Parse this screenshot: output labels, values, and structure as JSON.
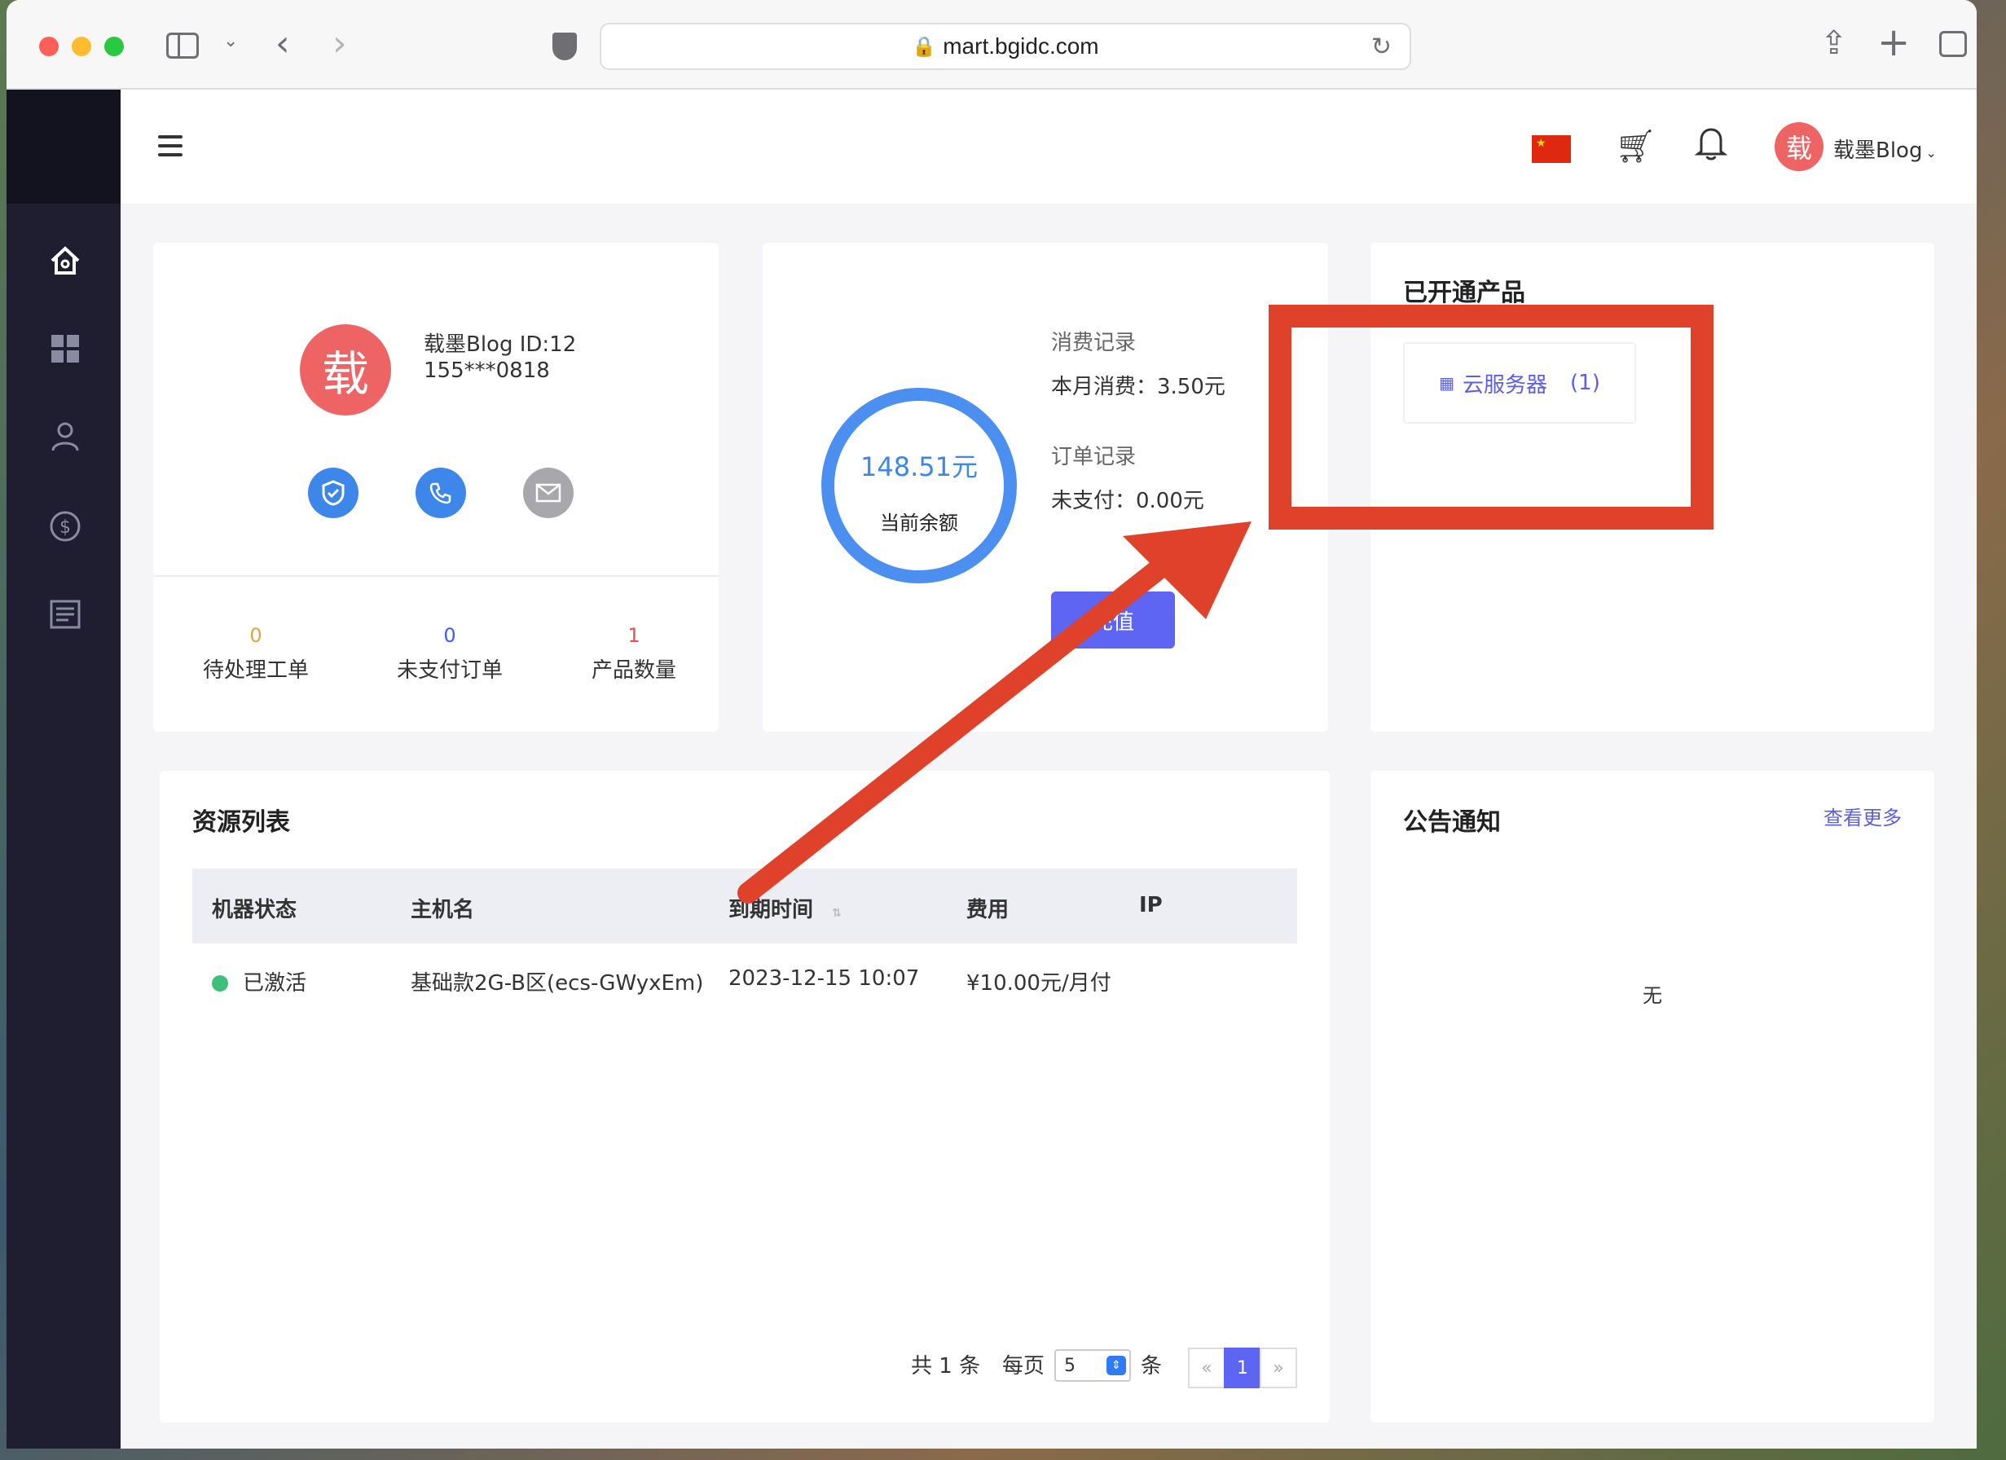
{
  "browser": {
    "url": "mart.bgidc.com"
  },
  "header": {
    "user_avatar_char": "载",
    "user_name": "载墨Blog",
    "caret": "⌄"
  },
  "profile": {
    "avatar_char": "载",
    "name_line": "载墨Blog ID:12",
    "phone": "155***0818",
    "stats": [
      {
        "value": "0",
        "label": "待处理工单",
        "color": "#e6a23c"
      },
      {
        "value": "0",
        "label": "未支付订单",
        "color": "#3d60e6"
      },
      {
        "value": "1",
        "label": "产品数量",
        "color": "#ee4d4d"
      }
    ]
  },
  "balance": {
    "amount": "148.51元",
    "label": "当前余额",
    "consume_title": "消费记录",
    "consume_value": "本月消费：3.50元",
    "order_title": "订单记录",
    "order_value": "未支付：0.00元",
    "button_label": "充值"
  },
  "products": {
    "title": "已开通产品",
    "items": [
      {
        "name": "云服务器",
        "count": "(1)"
      }
    ]
  },
  "resources": {
    "title": "资源列表",
    "columns": [
      "机器状态",
      "主机名",
      "到期时间",
      "费用",
      "IP"
    ],
    "rows": [
      {
        "status": "已激活",
        "hostname": "基础款2G-B区(ecs-GWyxEm)",
        "expire": "2023-12-15 10:07",
        "fee": "¥10.00元/月付",
        "ip": ""
      }
    ],
    "pager": {
      "total": "共 1 条",
      "per_page_label": "每页",
      "per_page_value": "5",
      "per_page_unit": "条",
      "prev": "«",
      "current": "1",
      "next": "»"
    }
  },
  "notices": {
    "title": "公告通知",
    "more": "查看更多",
    "empty": "无"
  },
  "colors": {
    "accent": "#5e65f2",
    "annotation_red": "#e0412b"
  }
}
